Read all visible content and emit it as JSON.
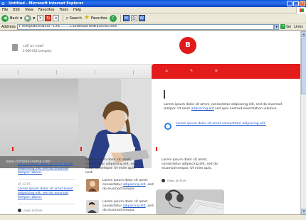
{
  "window": {
    "title": "Untitled - Microsoft Internet Explorer",
    "buttons": [
      "_",
      "□",
      "×"
    ]
  },
  "menu": [
    "File",
    "Edit",
    "View",
    "Favorites",
    "Tools",
    "Help"
  ],
  "toolbar": {
    "back": "Back",
    "search": "Search",
    "favorites": "Favorites"
  },
  "address": {
    "label": "Address",
    "value": "F:\\templates\\Hanes~13%..........CSS\\Whaat RedFaces\\ex.html",
    "go": "Go",
    "links": "Links"
  },
  "status": "",
  "page": {
    "call_label": "call us now!",
    "call_number": "1-000-012-company",
    "logo_text": "B",
    "hero_caption": "www.companyname.com",
    "intro": {
      "text_before": "Lorem ipsum dolor sit amet, consectetur adipiscing elit, sed do eiusmod tempor. Ut enim ",
      "link": "adipiscing elit",
      "text_after": " sed quis nostrud exercitation ullamco."
    },
    "ring_link": "Lorem ipsum dolor sit amet consectetur adipiscing elit.",
    "news": [
      {
        "date": "05.12.05",
        "link": "Lorem ipsum dolor sit amet lorem adipiscing elit, sed do eiusmod tempor labore."
      },
      {
        "date": "05.12.05",
        "link": "Lorem ipsum dolor sit amet lorem adipiscing elit, sed do eiusmod tempor labore."
      }
    ],
    "news_more": "news archive",
    "col2": {
      "text": "Lorem ipsum dolor sit amet, consectetur adipiscing elit, sed do eiusmod tempor. Ut enim quis nost.",
      "items": [
        {
          "pre": "Lorem ipsum dolor sit amet consectetur ",
          "link": "adipiscing elit",
          "post": ", sed do eiusmod tempor."
        },
        {
          "pre": "Lorem ipsum dolor sit amet consectetur ",
          "link": "adipiscing elit",
          "post": ", sed do eiusmod tempor."
        }
      ]
    },
    "col3": {
      "text": "Lorem ipsum dolor sit amet, consectetur adipiscing elit, sed do eiusmod tempor. Ut enim quis.",
      "more": "news archive"
    }
  }
}
